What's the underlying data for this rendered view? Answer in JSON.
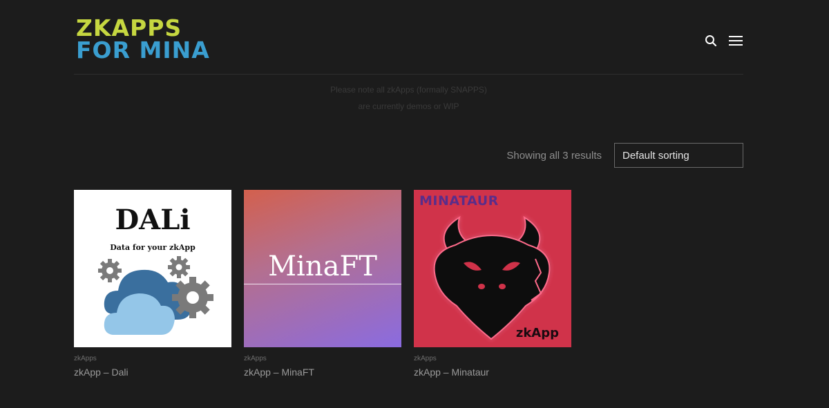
{
  "logo": {
    "line1": "ZKAPPS",
    "line2": "FOR MINA"
  },
  "header": {
    "search_icon": "search-icon",
    "menu_icon": "hamburger-menu-icon"
  },
  "notice": {
    "line1": "Please note all zkApps (formally SNAPPS)",
    "line2": "are currently demos or WIP"
  },
  "toolbar": {
    "result_count": "Showing all 3 results",
    "sort_selected": "Default sorting"
  },
  "products": [
    {
      "category": "zkApps",
      "title": "zkApp – Dali",
      "image_title": "DALi",
      "image_subtitle": "Data for your zkApp"
    },
    {
      "category": "zkApps",
      "title": "zkApp – MinaFT",
      "image_title": "MinaFT"
    },
    {
      "category": "zkApps",
      "title": "zkApp – Minataur",
      "image_label": "MINATAUR",
      "image_badge": "zkApp"
    }
  ],
  "colors": {
    "background": "#1c1c1c",
    "logo_green": "#c6d740",
    "logo_blue": "#3a9ed0",
    "minataur_bg": "#d0334a"
  }
}
